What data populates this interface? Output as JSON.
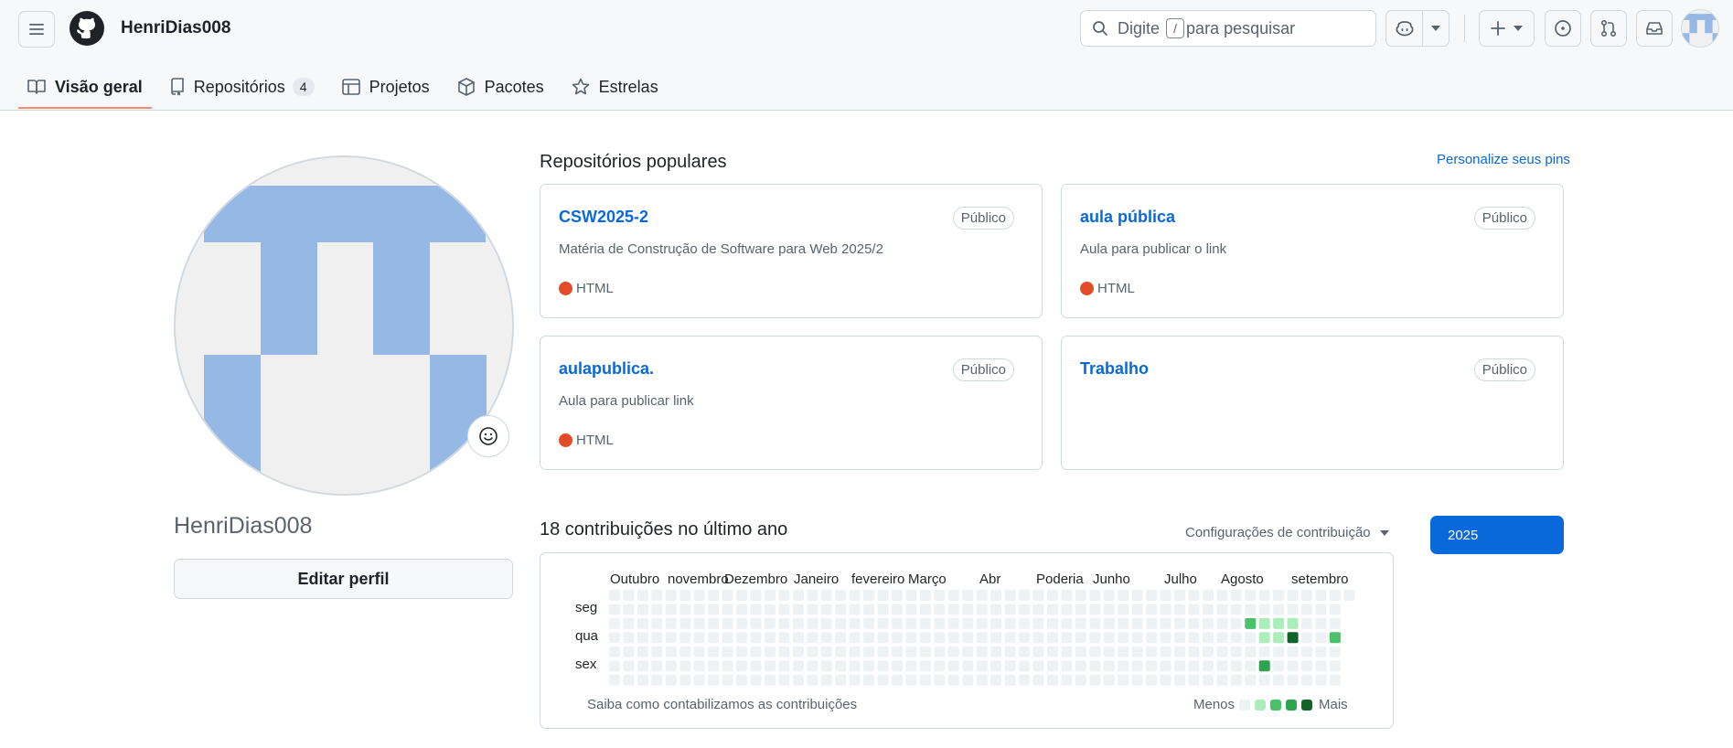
{
  "header": {
    "username": "HenriDias008",
    "search": {
      "prefix": "Digite",
      "key": "/",
      "suffix": "para pesquisar"
    },
    "icons": [
      "menu-icon",
      "github-logo-icon",
      "search-icon",
      "copilot-icon",
      "chevron-down-icon",
      "plus-icon",
      "issues-icon",
      "pull-request-icon",
      "inbox-icon"
    ]
  },
  "tabs": [
    {
      "label": "Visão geral",
      "icon": "book-icon",
      "active": true
    },
    {
      "label": "Repositórios",
      "icon": "repo-icon",
      "count": "4"
    },
    {
      "label": "Projetos",
      "icon": "table-icon"
    },
    {
      "label": "Pacotes",
      "icon": "package-icon"
    },
    {
      "label": "Estrelas",
      "icon": "star-icon"
    }
  ],
  "profile": {
    "name": "HenriDias008",
    "edit_label": "Editar perfil",
    "avatar_color": "#95b8e5"
  },
  "popular": {
    "title": "Repositórios populares",
    "customize": "Personalize seus pins",
    "repos": [
      {
        "name": "CSW2025-2",
        "visibility": "Público",
        "description": "Matéria de Construção de Software para Web 2025/2",
        "language": "HTML"
      },
      {
        "name": "aula pública",
        "visibility": "Público",
        "description": "Aula para publicar o link",
        "language": "HTML"
      },
      {
        "name": "aulapublica.",
        "visibility": "Público",
        "description": "Aula para publicar link",
        "language": "HTML"
      },
      {
        "name": "Trabalho",
        "visibility": "Público",
        "description": "",
        "language": ""
      }
    ],
    "language_color": "#e34c26"
  },
  "contributions": {
    "title": "18 contribuições no último ano",
    "settings": "Configurações de contribuição",
    "year": "2025",
    "months": [
      "Outubro",
      "novembro",
      "Dezembro",
      "Janeiro",
      "fevereiro",
      "Março",
      "Abr",
      "Poderia",
      "Junho",
      "Julho",
      "Agosto",
      "setembro"
    ],
    "days": [
      "seg",
      "qua",
      "sex"
    ],
    "footer": "Saiba como contabilizamos as contribuições",
    "less": "Menos",
    "more": "Mais",
    "levels": [
      "#eff2f5",
      "#aceebb",
      "#4ac26b",
      "#2da44e",
      "#116329"
    ],
    "weeks": 53,
    "active_cells": [
      {
        "week": 45,
        "day": 2,
        "level": 2
      },
      {
        "week": 46,
        "day": 2,
        "level": 1
      },
      {
        "week": 46,
        "day": 3,
        "level": 1
      },
      {
        "week": 46,
        "day": 5,
        "level": 3
      },
      {
        "week": 47,
        "day": 2,
        "level": 1
      },
      {
        "week": 47,
        "day": 3,
        "level": 1
      },
      {
        "week": 48,
        "day": 2,
        "level": 1
      },
      {
        "week": 48,
        "day": 3,
        "level": 4
      },
      {
        "week": 51,
        "day": 3,
        "level": 2
      }
    ]
  }
}
